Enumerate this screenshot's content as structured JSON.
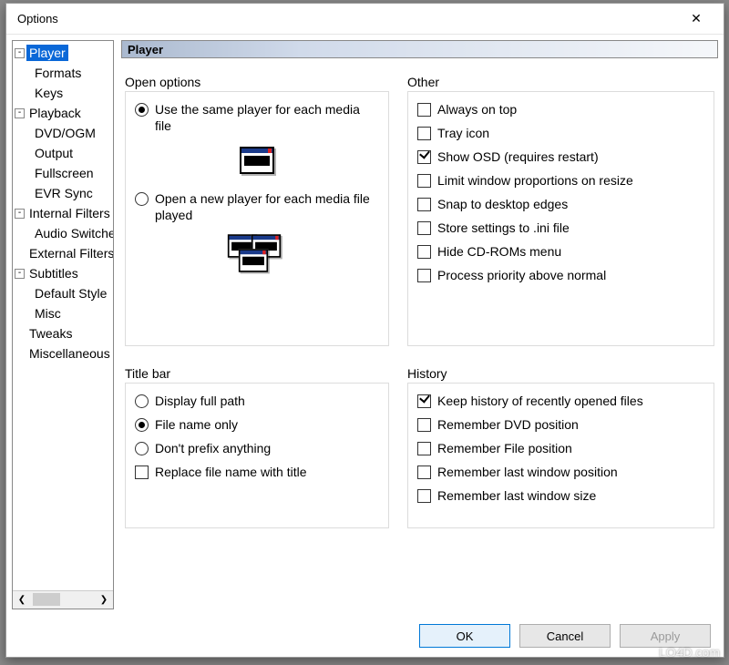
{
  "window": {
    "title": "Options"
  },
  "tree": {
    "items": [
      {
        "label": "Player",
        "depth": 0,
        "toggle": "-",
        "selected": true
      },
      {
        "label": "Formats",
        "depth": 1
      },
      {
        "label": "Keys",
        "depth": 1
      },
      {
        "label": "Playback",
        "depth": 0,
        "toggle": "-"
      },
      {
        "label": "DVD/OGM",
        "depth": 1
      },
      {
        "label": "Output",
        "depth": 1
      },
      {
        "label": "Fullscreen",
        "depth": 1
      },
      {
        "label": "EVR Sync",
        "depth": 1
      },
      {
        "label": "Internal Filters",
        "depth": 0,
        "toggle": "-"
      },
      {
        "label": "Audio Switcher",
        "depth": 1
      },
      {
        "label": "External Filters",
        "depth": 0
      },
      {
        "label": "Subtitles",
        "depth": 0,
        "toggle": "-"
      },
      {
        "label": "Default Style",
        "depth": 1
      },
      {
        "label": "Misc",
        "depth": 1
      },
      {
        "label": "Tweaks",
        "depth": 0
      },
      {
        "label": "Miscellaneous",
        "depth": 0
      }
    ]
  },
  "panel": {
    "header": "Player",
    "open_options": {
      "legend": "Open options",
      "radio_same": "Use the same player for each media file",
      "radio_new": "Open a new player for each media file played",
      "selected": "same"
    },
    "title_bar": {
      "legend": "Title bar",
      "radio_full": "Display full path",
      "radio_name": "File name only",
      "radio_none": "Don't prefix anything",
      "selected": "name",
      "replace_chk": {
        "label": "Replace file name with title",
        "checked": false
      }
    },
    "other": {
      "legend": "Other",
      "items": [
        {
          "label": "Always on top",
          "checked": false
        },
        {
          "label": "Tray icon",
          "checked": false
        },
        {
          "label": "Show OSD (requires restart)",
          "checked": true
        },
        {
          "label": "Limit window proportions on resize",
          "checked": false
        },
        {
          "label": "Snap to desktop edges",
          "checked": false
        },
        {
          "label": "Store settings to .ini file",
          "checked": false
        },
        {
          "label": "Hide CD-ROMs menu",
          "checked": false
        },
        {
          "label": "Process priority above normal",
          "checked": false
        }
      ]
    },
    "history": {
      "legend": "History",
      "items": [
        {
          "label": "Keep history of recently opened files",
          "checked": true
        },
        {
          "label": "Remember DVD position",
          "checked": false
        },
        {
          "label": "Remember File position",
          "checked": false
        },
        {
          "label": "Remember last window position",
          "checked": false
        },
        {
          "label": "Remember last window size",
          "checked": false
        }
      ]
    }
  },
  "buttons": {
    "ok": "OK",
    "cancel": "Cancel",
    "apply": "Apply"
  },
  "watermark": "LO4D.com"
}
